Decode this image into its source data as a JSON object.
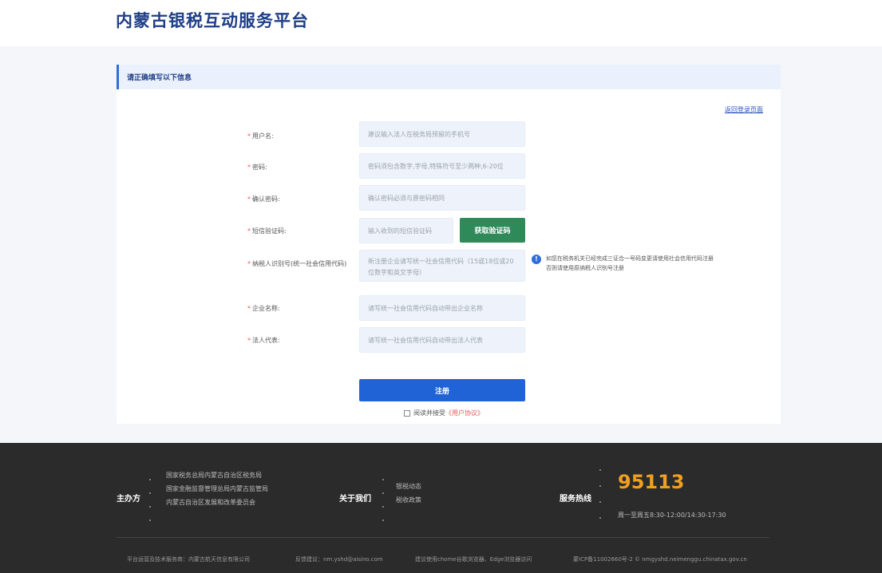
{
  "header": {
    "title": "内蒙古银税互动服务平台"
  },
  "form": {
    "section_title": "请正确填写以下信息",
    "back_link": "返回登录页面",
    "fields": [
      {
        "label": "用户名:",
        "placeholder": "建议输入法人在税务局预留的手机号"
      },
      {
        "label": "密码:",
        "placeholder": "密码须包含数字,字母,特殊符号至少两种,6-20位"
      },
      {
        "label": "确认密码:",
        "placeholder": "确认密码必须与原密码相同"
      },
      {
        "label": "短信验证码:",
        "placeholder": "输入收到的短信验证码"
      },
      {
        "label": "纳税人识别号(统一社会信用代码)",
        "placeholder": "新注册企业请写统一社会信用代码（15或18位或20位数字和英文字母）"
      },
      {
        "label": "企业名称:",
        "placeholder": "请写统一社会信用代码自动带出企业名称"
      },
      {
        "label": "法人代表:",
        "placeholder": "请写统一社会信用代码自动带出法人代表"
      }
    ],
    "required_mark": "*",
    "sms_button": "获取验证码",
    "info_note": "如您在税务机关已经完成三证合一号码变更请使用社会信用代码注册否则请使用原纳税人识别号注册",
    "info_icon": "!",
    "register_button": "注册",
    "agree_text": "阅读并接受",
    "agree_link": "《用户协议》"
  },
  "footer": {
    "host_title": "主办方",
    "hosts": [
      "国家税务总局内蒙古自治区税务局",
      "国家金融监督管理总局内蒙古监管局",
      "内蒙古自治区发展和改革委员会"
    ],
    "about_title": "关于我们",
    "about_items": [
      "银税动态",
      "税收政策"
    ],
    "hotline_title": "服务热线",
    "hotline_number": "95113",
    "hotline_hours": "周一至周五8:30-12:00/14:30-17:30",
    "bottom": {
      "operator": "平台运营及技术服务商：内蒙古航天信息有限公司",
      "feedback": "反馈建议：nm.yshd@aisino.com",
      "browser": "建议使用chome谷歌浏览器、Edge浏览器访问",
      "icp": "蒙ICP备11002660号-2 © nmgyshd.neimenggu.chinatax.gov.cn"
    }
  }
}
